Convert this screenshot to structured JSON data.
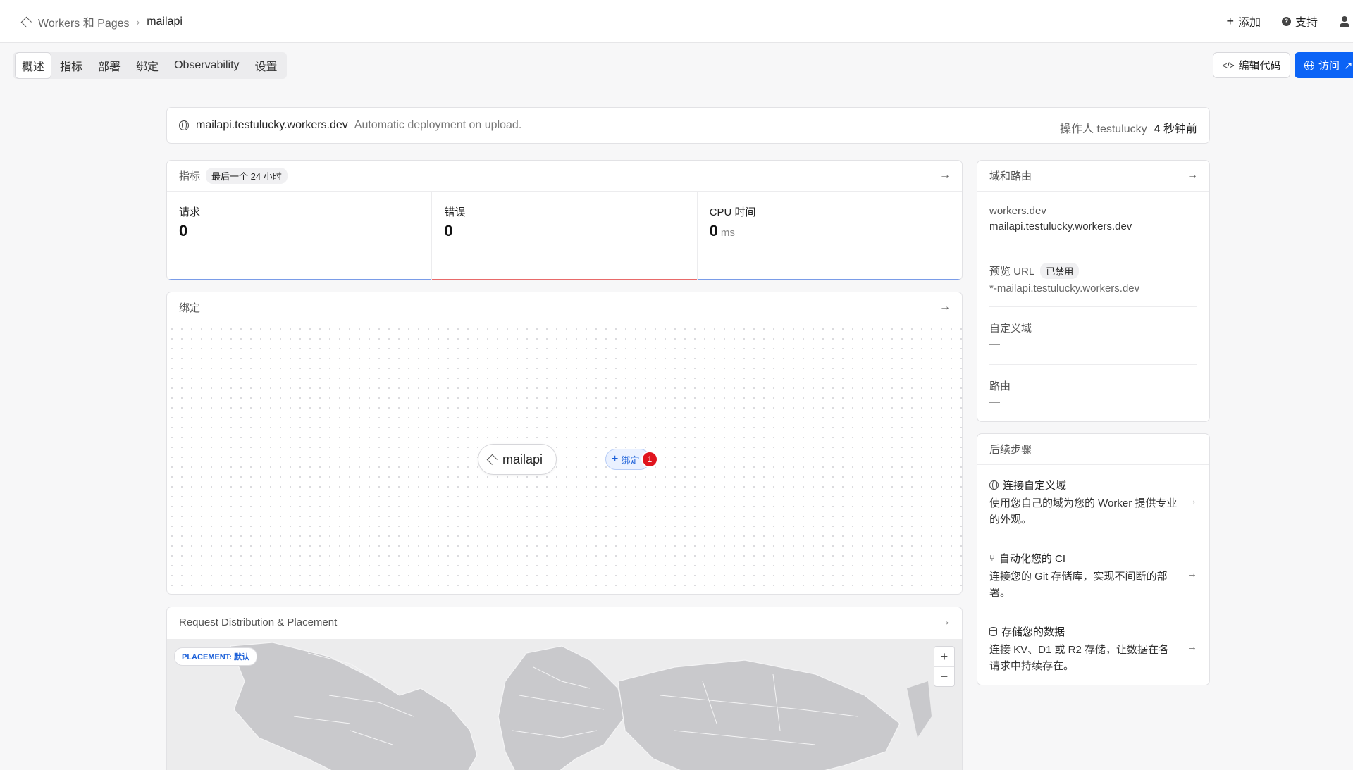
{
  "breadcrumb": {
    "root": "Workers 和 Pages",
    "current": "mailapi"
  },
  "top_actions": {
    "add": "添加",
    "support": "支持"
  },
  "tabs": [
    "概述",
    "指标",
    "部署",
    "绑定",
    "Observability",
    "设置"
  ],
  "buttons": {
    "edit_code": "编辑代码",
    "visit": "访问"
  },
  "deployment": {
    "url": "mailapi.testulucky.workers.dev",
    "message": "Automatic deployment on upload.",
    "operator": "操作人 testulucky",
    "time": "4 秒钟前"
  },
  "metrics": {
    "title": "指标",
    "range": "最后一个 24 小时",
    "requests": {
      "label": "请求",
      "value": "0"
    },
    "errors": {
      "label": "错误",
      "value": "0"
    },
    "cpu": {
      "label": "CPU 时间",
      "value": "0",
      "unit": "ms"
    }
  },
  "bindings": {
    "title": "绑定",
    "node": "mailapi",
    "bind_label": "绑定",
    "badge": "1"
  },
  "placement": {
    "title": "Request Distribution & Placement",
    "tag": "PLACEMENT: 默认",
    "zoom_in": "+",
    "zoom_out": "−"
  },
  "domains": {
    "title": "域和路由",
    "workers_dev": {
      "label": "workers.dev",
      "value": "mailapi.testulucky.workers.dev"
    },
    "preview": {
      "label": "预览 URL",
      "badge": "已禁用",
      "value": "*-mailapi.testulucky.workers.dev"
    },
    "custom": {
      "label": "自定义域",
      "value": "—"
    },
    "routes": {
      "label": "路由",
      "value": "—"
    }
  },
  "next_steps": {
    "title": "后续步骤",
    "items": [
      {
        "title": "连接自定义域",
        "desc": "使用您自己的域为您的 Worker 提供专业的外观。"
      },
      {
        "title": "自动化您的 CI",
        "desc": "连接您的 Git 存储库，实现不间断的部署。"
      },
      {
        "title": "存储您的数据",
        "desc": "连接 KV、D1 或 R2 存储，让数据在各请求中持续存在。"
      }
    ]
  },
  "colors": {
    "accent": "#0b63f6",
    "error_line": "#e86a6a",
    "request_line": "#7a9ce8",
    "badge": "#e0141e"
  }
}
